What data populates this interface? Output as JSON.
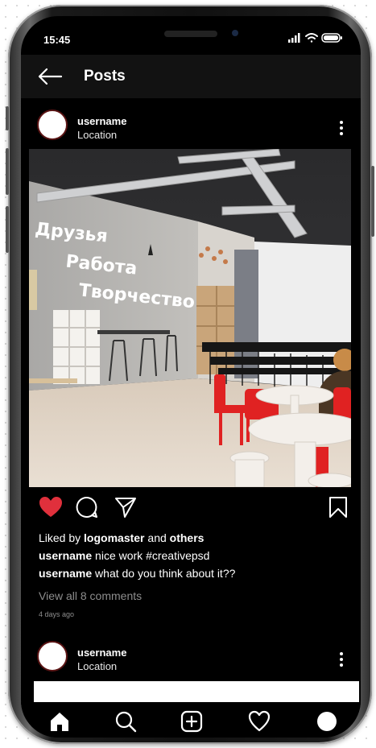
{
  "status_bar": {
    "time": "15:45",
    "icons": [
      "signal-icon",
      "wifi-icon",
      "battery-icon"
    ]
  },
  "header": {
    "title": "Posts",
    "back_icon": "back-arrow-icon"
  },
  "post": {
    "username": "username",
    "location": "Location",
    "image_signage": [
      "Друзья",
      "Работа",
      "Творчество"
    ],
    "actions": [
      "heart-icon",
      "comment-icon",
      "share-icon",
      "bookmark-icon"
    ],
    "liked": true,
    "liked_by": {
      "prefix": "Liked by",
      "user": "logomaster",
      "joiner": "and",
      "others": "others"
    },
    "comments": [
      {
        "user": "username",
        "text": "nice work #creativepsd"
      },
      {
        "user": "username",
        "text": "what do you think about it??"
      }
    ],
    "view_all": "View all 8 comments",
    "time_ago": "4 days ago"
  },
  "next_post": {
    "username": "username",
    "location": "Location"
  },
  "tabbar": {
    "items": [
      "home-icon",
      "search-icon",
      "add-icon",
      "activity-icon",
      "profile-icon"
    ],
    "active": "home-icon"
  },
  "colors": {
    "like": "#e0303c",
    "background": "#000000",
    "header": "#121212",
    "muted": "#8d8d8d",
    "chair": "#e02222"
  }
}
